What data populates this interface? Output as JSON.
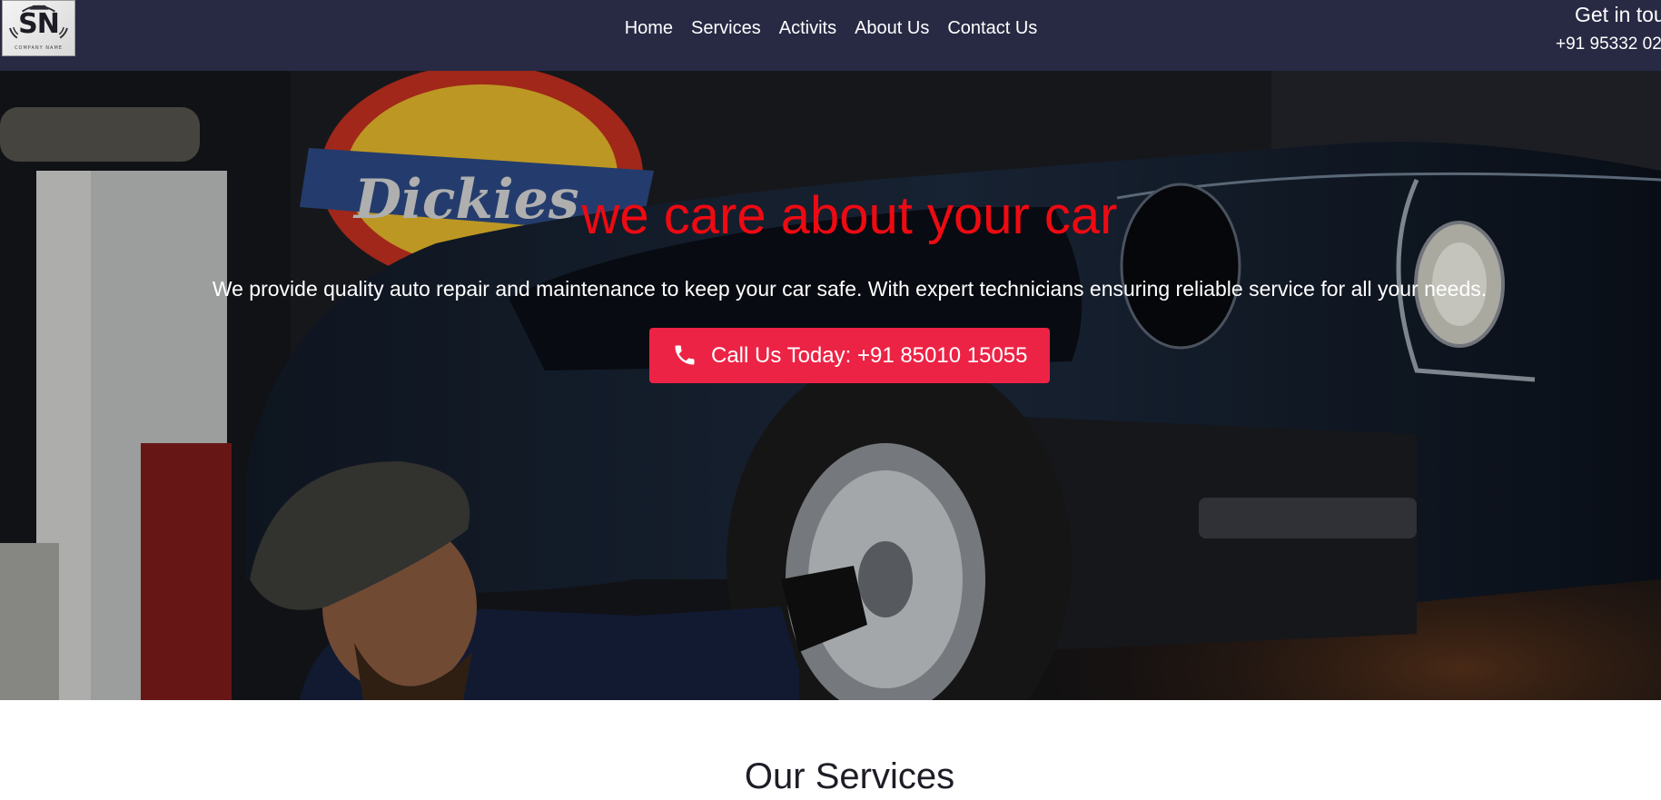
{
  "brand": {
    "logo_letters": "SN",
    "logo_subtitle": "COMPANY NAME"
  },
  "nav": {
    "items": [
      {
        "label": "Home"
      },
      {
        "label": "Services"
      },
      {
        "label": "Activits"
      },
      {
        "label": "About Us"
      },
      {
        "label": "Contact Us"
      }
    ]
  },
  "contact": {
    "title": "Get in tou",
    "phone": "+91 95332 02"
  },
  "hero": {
    "title": "we care about your car",
    "text": "We provide quality auto repair and maintenance to keep your car safe. With expert technicians ensuring reliable service for all your needs.",
    "cta_label": "Call Us Today: +91 85010 15055",
    "sign_text": "Dickies",
    "phone_icon": "phone-icon"
  },
  "services": {
    "title": "Our Services"
  },
  "colors": {
    "navbar": "#282a44",
    "hero_title": "#ee0a12",
    "cta": "#ec2345"
  }
}
